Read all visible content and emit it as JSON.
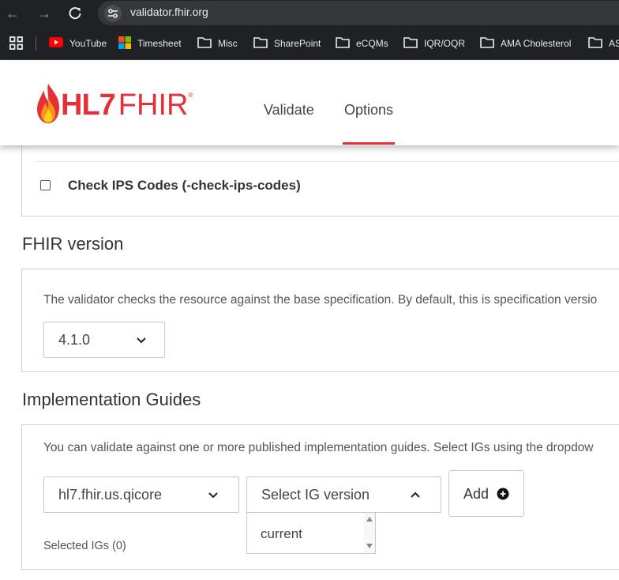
{
  "browser": {
    "url": "validator.fhir.org",
    "bookmarks": [
      {
        "label": "YouTube",
        "icon": "youtube-icon"
      },
      {
        "label": "Timesheet",
        "icon": "microsoft-icon"
      },
      {
        "label": "Misc",
        "icon": "folder-icon"
      },
      {
        "label": "SharePoint",
        "icon": "folder-icon"
      },
      {
        "label": "eCQMs",
        "icon": "folder-icon"
      },
      {
        "label": "IQR/OQR",
        "icon": "folder-icon"
      },
      {
        "label": "AMA Cholesterol",
        "icon": "folder-icon"
      },
      {
        "label": "AS",
        "icon": "folder-icon"
      }
    ]
  },
  "header": {
    "logo_hl7": "HL7",
    "logo_fhir": "FHIR",
    "logo_reg": "®",
    "nav": [
      {
        "label": "Validate",
        "active": false
      },
      {
        "label": "Options",
        "active": true
      }
    ],
    "accent_color": "#e53038"
  },
  "options": {
    "check_ips_label": "Check IPS Codes (-check-ips-codes)",
    "check_ips_checked": false
  },
  "fhir_version": {
    "title": "FHIR version",
    "description": "The validator checks the resource against the base specification. By default, this is specification versio",
    "selected": "4.1.0"
  },
  "implementation_guides": {
    "title": "Implementation Guides",
    "description": "You can validate against one or more published implementation guides. Select IGs using the dropdow",
    "ig_selected": "hl7.fhir.us.qicore",
    "version_placeholder": "Select IG version",
    "version_options": [
      "current"
    ],
    "add_label": "Add",
    "selected_igs_label": "Selected IGs (0)"
  }
}
